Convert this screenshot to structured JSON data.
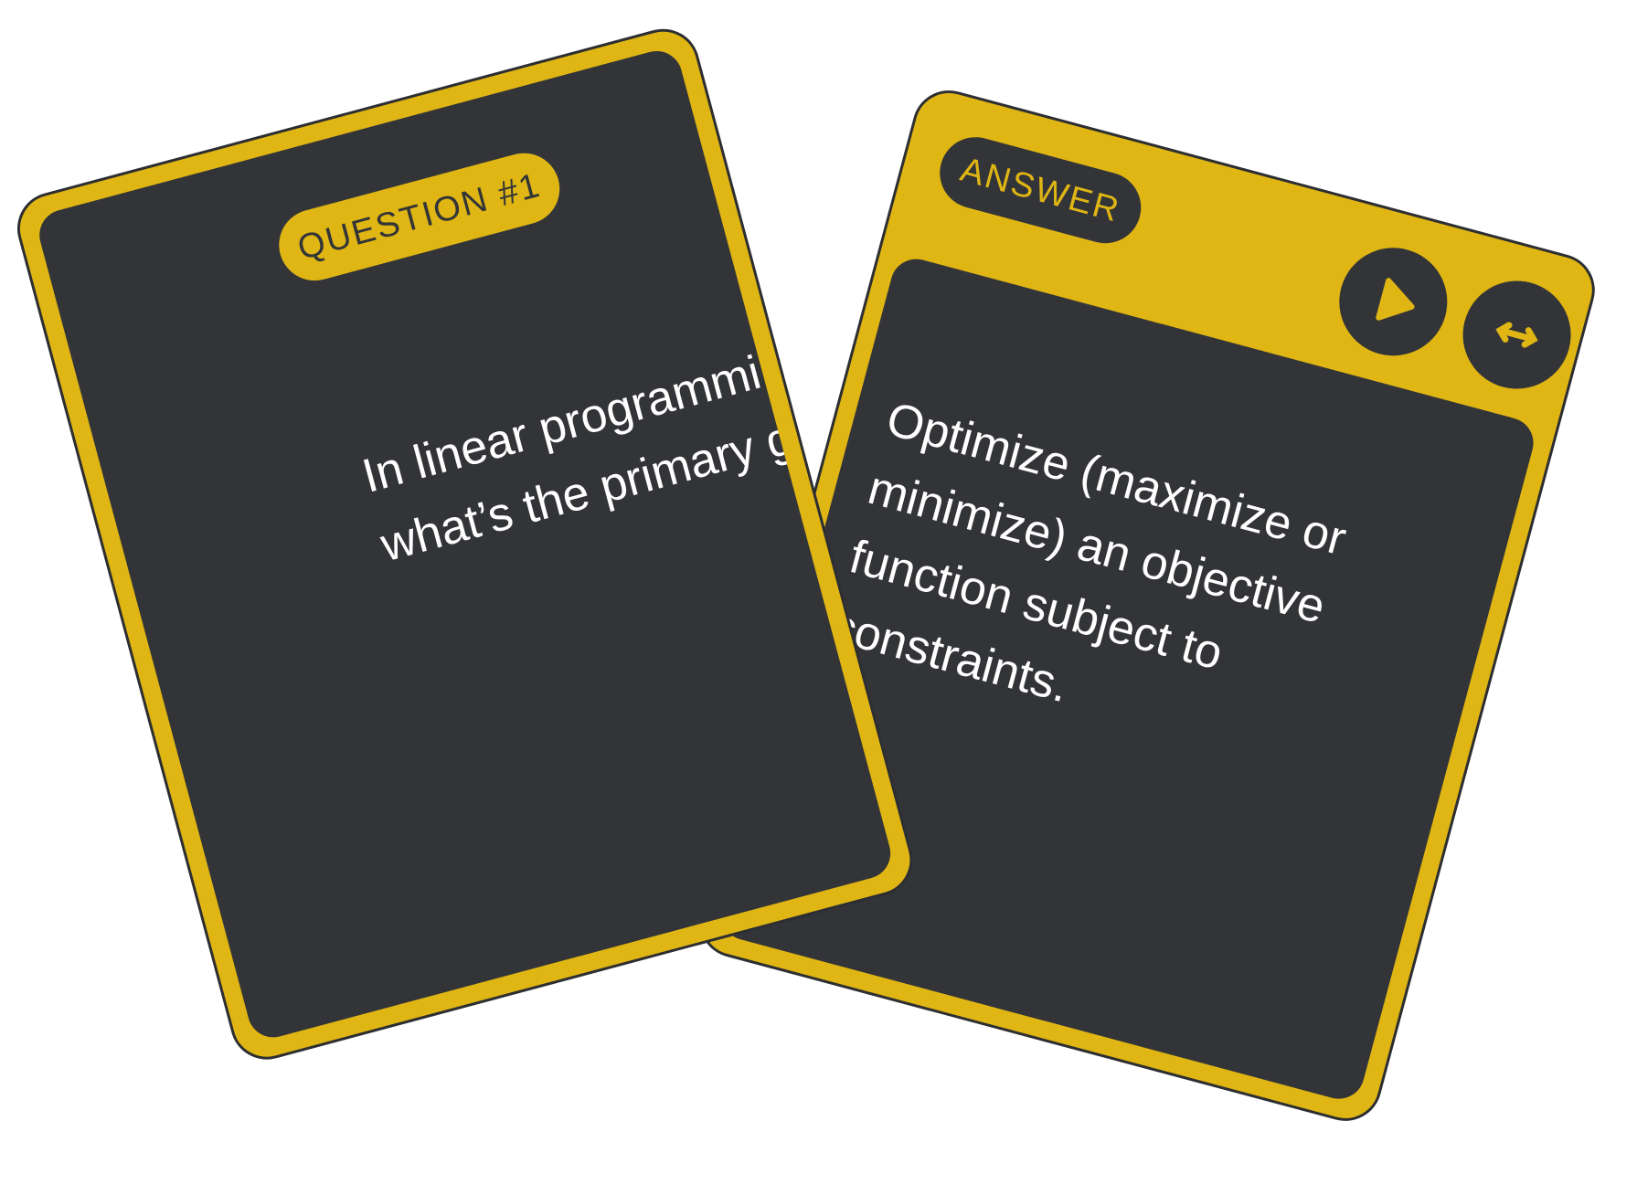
{
  "colors": {
    "accent": "#dfb614",
    "card_dark": "#333437",
    "text": "#ffffff"
  },
  "question_card": {
    "label": "QUESTION #1",
    "text": "In linear programming, what’s the primary goal?"
  },
  "answer_card": {
    "label": "ANSWER",
    "text": "Optimize (maximize or minimize) an objective function subject to constraints.",
    "buttons": [
      {
        "icon": "play-icon"
      },
      {
        "icon": "expand-arrows-icon"
      }
    ]
  }
}
